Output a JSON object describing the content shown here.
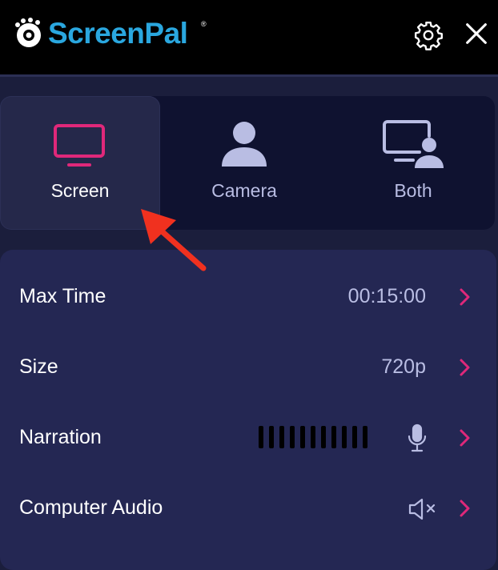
{
  "app": {
    "name": "ScreenPal",
    "trademark": "®"
  },
  "header": {
    "settings_icon": "gear-icon",
    "close_icon": "close-icon"
  },
  "modes": [
    {
      "label": "Screen",
      "icon": "monitor-icon",
      "selected": true,
      "accent": "#e0287a"
    },
    {
      "label": "Camera",
      "icon": "person-icon",
      "selected": false
    },
    {
      "label": "Both",
      "icon": "monitor-person-icon",
      "selected": false
    }
  ],
  "settings": {
    "max_time": {
      "label": "Max Time",
      "value": "00:15:00"
    },
    "size": {
      "label": "Size",
      "value": "720p"
    },
    "narration": {
      "label": "Narration",
      "meter_bars": 11,
      "icon": "microphone-icon"
    },
    "computer_audio": {
      "label": "Computer Audio",
      "icon": "speaker-muted-icon"
    }
  },
  "colors": {
    "brand": "#2aa7df",
    "accent": "#e0287a",
    "panel": "#242753",
    "muted_text": "#b9bde3",
    "annotation_arrow": "#f0311f"
  }
}
